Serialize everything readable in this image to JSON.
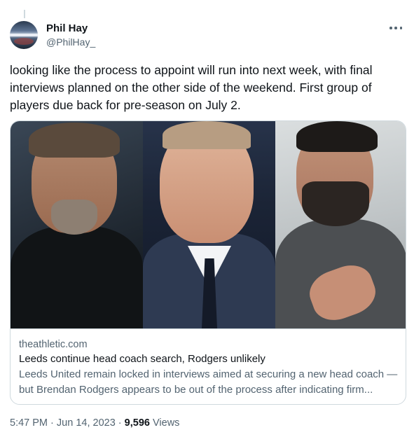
{
  "author": {
    "display_name": "Phil Hay",
    "handle": "@PhilHay_"
  },
  "more_icon": "more-horizontal-icon",
  "tweet": {
    "text": "looking like the process to appoint will run into next week, with final interviews planned on the other side of the weekend. First group of players due back for pre-season on July 2."
  },
  "link_card": {
    "domain": "theathletic.com",
    "title": "Leeds continue head coach search, Rodgers unlikely",
    "description": "Leeds United remain locked in interviews aimed at securing a new head coach — but Brendan Rodgers appears to be out of the process after indicating firm..."
  },
  "meta": {
    "time": "5:47 PM",
    "separator": "·",
    "date": "Jun 14, 2023",
    "views_count": "9,596",
    "views_label": "Views"
  },
  "colors": {
    "text_primary": "#0f1419",
    "text_secondary": "#536471",
    "border": "#cfd9de"
  }
}
